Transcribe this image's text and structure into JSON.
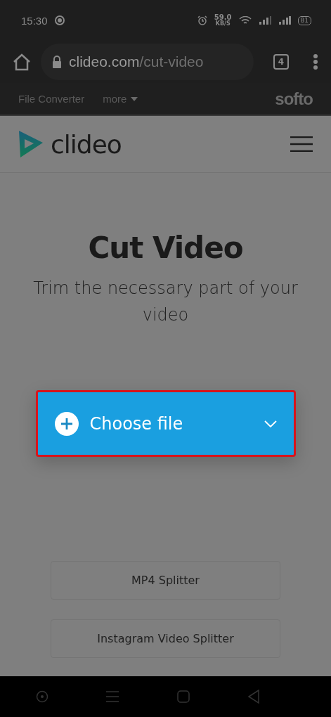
{
  "status_bar": {
    "time": "15:30",
    "speed": "59.0",
    "speed_unit": "KB/S",
    "battery": "81"
  },
  "browser": {
    "url_host": "clideo.com",
    "url_path": "/cut-video",
    "tab_count": "4"
  },
  "top_nav": {
    "items": [
      "File Converter",
      "more"
    ],
    "brand": "softo"
  },
  "header": {
    "logo": "clideo"
  },
  "main": {
    "title": "Cut Video",
    "subtitle": "Trim the necessary part of your video",
    "upload_button": {
      "label": "Choose file",
      "highlighted": true
    }
  },
  "related_links": [
    "MP4 Splitter",
    "Instagram Video Splitter"
  ]
}
